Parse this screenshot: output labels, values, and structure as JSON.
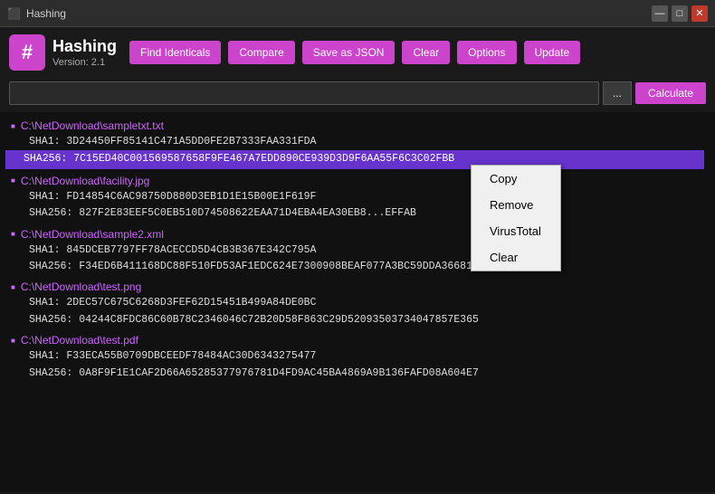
{
  "titlebar": {
    "title": "Hashing",
    "minimize": "—",
    "maximize": "□",
    "close": "✕"
  },
  "app": {
    "name": "Hashing",
    "version": "Version: 2.1",
    "logo": "#"
  },
  "toolbar": {
    "find_identicals": "Find Identicals",
    "compare": "Compare",
    "save_as_json": "Save as JSON",
    "clear": "Clear",
    "options": "Options",
    "update": "Update"
  },
  "search": {
    "placeholder": "",
    "browse_label": "...",
    "calculate_label": "Calculate"
  },
  "files": [
    {
      "path": "C:\\NetDownload\\sampletxt.txt",
      "sha1": "SHA1: 3D24450FF85141C471A5DD0FE2B7333FAA331FDA",
      "sha256": "SHA256: 7C15ED40C001569587658F9FE467A7EDD890CE939D3D9F6AA55F6C3C02FBB",
      "sha256_selected": true
    },
    {
      "path": "C:\\NetDownload\\facility.jpg",
      "sha1": "SHA1: FD14854C6AC98750D880D3EB1D1E15B00E1F619F",
      "sha256": "SHA256: 827F2E83EEF5C0EB510D74508622EAA71D4EBA4EA30EB8...EFFAB",
      "sha256_selected": false
    },
    {
      "path": "C:\\NetDownload\\sample2.xml",
      "sha1": "SHA1: 845DCEB7797FF78ACECCD5D4CB3B367E342C795A",
      "sha256": "SHA256: F34ED6B411168DC88F510FD53AF1EDC624E7300908BEAF077A3BC59DDA36681E",
      "sha256_selected": false
    },
    {
      "path": "C:\\NetDownload\\test.png",
      "sha1": "SHA1: 2DEC57C675C6268D3FEF62D15451B499A84DE0BC",
      "sha256": "SHA256: 04244C8FDC86C60B78C2346046C72B20D58F863C29D52093503734047857E365",
      "sha256_selected": false
    },
    {
      "path": "C:\\NetDownload\\test.pdf",
      "sha1": "SHA1: F33ECA55B0709DBCEEDF78484AC30D6343275477",
      "sha256": "SHA256: 0A8F9F1E1CAF2D66A65285377976781D4FD9AC45BA4869A9B136FAFD08A604E7",
      "sha256_selected": false
    }
  ],
  "context_menu": {
    "copy": "Copy",
    "remove": "Remove",
    "virus_total": "VirusTotal",
    "clear": "Clear"
  }
}
